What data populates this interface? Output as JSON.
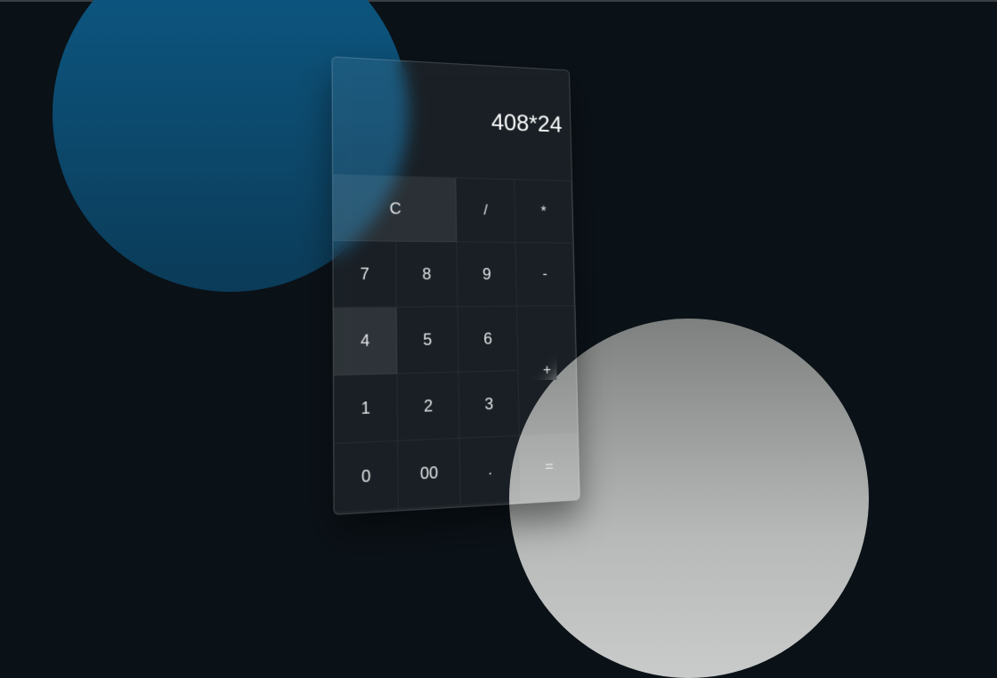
{
  "calculator": {
    "display": "408*24",
    "keys": {
      "clear": "C",
      "divide": "/",
      "multiply": "*",
      "seven": "7",
      "eight": "8",
      "nine": "9",
      "minus": "-",
      "four": "4",
      "five": "5",
      "six": "6",
      "plus": "+",
      "one": "1",
      "two": "2",
      "three": "3",
      "zero": "0",
      "double_zero": "00",
      "dot": ".",
      "equals": "="
    }
  },
  "colors": {
    "background": "#0a1117",
    "blue_circle": "#0d5a86",
    "grey_circle": "#b6b9b7"
  }
}
